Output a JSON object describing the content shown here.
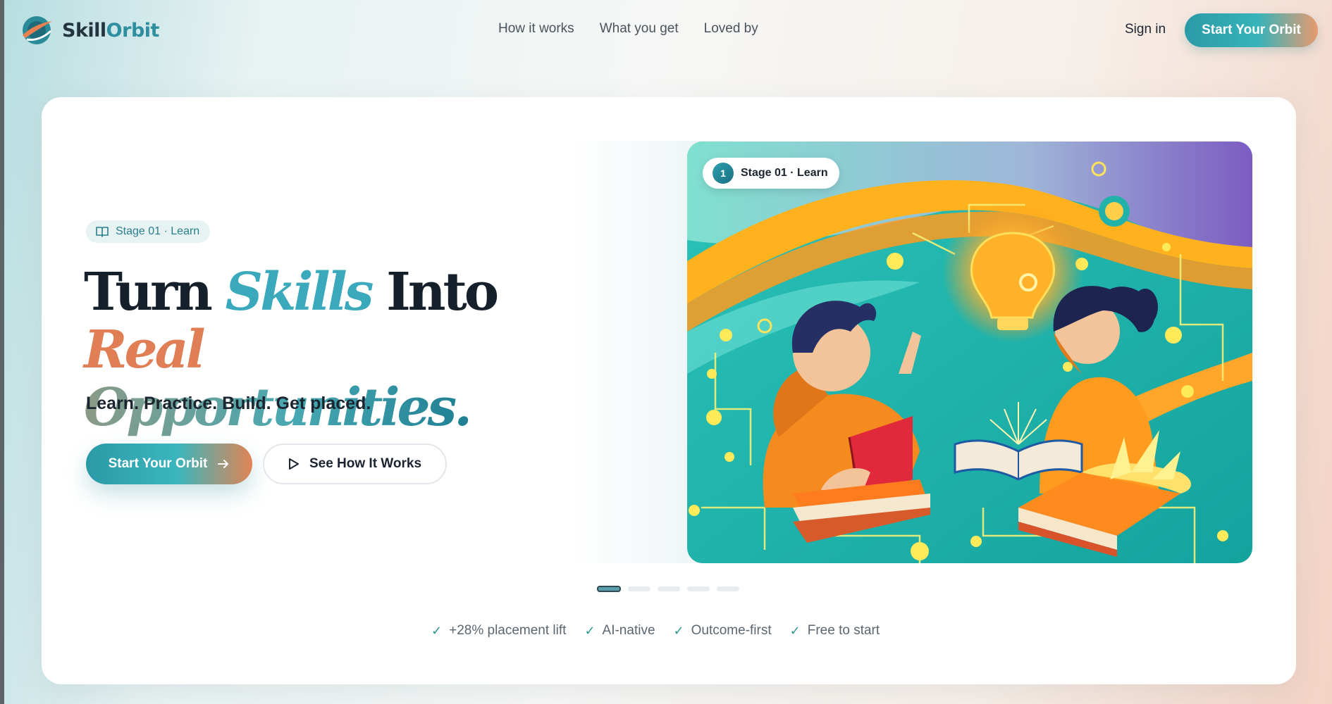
{
  "brand": {
    "name_part1": "Skill",
    "name_part2": "Orbit"
  },
  "nav": {
    "items": [
      {
        "label": "How it works"
      },
      {
        "label": "What you get"
      },
      {
        "label": "Loved by"
      }
    ]
  },
  "header": {
    "signin_label": "Sign in",
    "cta_label": "Start Your Orbit"
  },
  "hero": {
    "badge_label": "Stage 01 · Learn",
    "headline": {
      "w1": "Turn",
      "w2": "Skills",
      "w3": "Into",
      "w4": "Real",
      "w5": "Opportunities."
    },
    "tagline": "Learn. Practice. Build. Get placed.",
    "primary_cta": "Start Your Orbit",
    "secondary_cta": "See How It Works",
    "image_chip": {
      "number": "1",
      "label": "Stage 01 · Learn"
    }
  },
  "carousel": {
    "count": 5,
    "active_index": 0
  },
  "features": [
    {
      "label": "+28% placement lift"
    },
    {
      "label": "AI-native"
    },
    {
      "label": "Outcome-first"
    },
    {
      "label": "Free to start"
    }
  ],
  "colors": {
    "accent_teal": "#2a9aa7",
    "accent_orange": "#e07f55",
    "ink": "#15202b"
  }
}
